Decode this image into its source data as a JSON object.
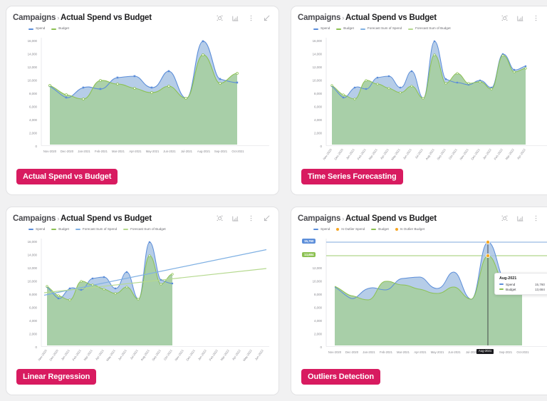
{
  "theme": {
    "badge_color": "#d81b60",
    "spend_color": "#5b8dd9",
    "budget_color": "#8cc152",
    "spend_fill": "#aec6e8",
    "budget_fill": "#a8cfa4",
    "outlier_color": "#f5a623",
    "axis_text": "#8a8a90",
    "card_bg": "#ffffff",
    "page_bg": "#f1f1f2"
  },
  "icons": [
    "focus-target-icon",
    "bar-chart-icon",
    "more-vertical-icon",
    "collapse-arrow-icon"
  ],
  "cards": [
    {
      "id": "actual-spend-vs-budget",
      "breadcrumb": "Campaigns",
      "separator": "›",
      "title": "Actual Spend vs Budget",
      "badge": "Actual Spend vs Budget",
      "legend": [
        {
          "label": "Spend",
          "color": "#5b8dd9",
          "shape": "line"
        },
        {
          "label": "Budget",
          "color": "#8cc152",
          "shape": "line"
        }
      ]
    },
    {
      "id": "time-series-forecasting",
      "breadcrumb": "Campaigns",
      "separator": "›",
      "title": "Actual Spend vs Budget",
      "badge": "Time Series Forecasting",
      "legend": [
        {
          "label": "Spend",
          "color": "#5b8dd9",
          "shape": "line"
        },
        {
          "label": "Budget",
          "color": "#8cc152",
          "shape": "line"
        },
        {
          "label": "Forecast Sum of Spend",
          "color": "#7fb0e3",
          "shape": "line"
        },
        {
          "label": "Forecast Sum of Budget",
          "color": "#b5d98f",
          "shape": "line"
        }
      ]
    },
    {
      "id": "linear-regression",
      "breadcrumb": "Campaigns",
      "separator": "›",
      "title": "Actual Spend vs Budget",
      "badge": "Linear Regression",
      "legend": [
        {
          "label": "Spend",
          "color": "#5b8dd9",
          "shape": "line"
        },
        {
          "label": "Budget",
          "color": "#8cc152",
          "shape": "line"
        },
        {
          "label": "Forecast Sum of Spend",
          "color": "#7fb0e3",
          "shape": "line"
        },
        {
          "label": "Forecast Sum of Budget",
          "color": "#b5d98f",
          "shape": "line"
        }
      ]
    },
    {
      "id": "outliers-detection",
      "breadcrumb": "Campaigns",
      "separator": "›",
      "title": "Actual Spend vs Budget",
      "badge": "Outliers Detection",
      "legend": [
        {
          "label": "Spend",
          "color": "#5b8dd9",
          "shape": "line"
        },
        {
          "label": "Is Outlier Spend",
          "color": "#f5a623",
          "shape": "dot"
        },
        {
          "label": "Budget",
          "color": "#8cc152",
          "shape": "line"
        },
        {
          "label": "Is Outlier Budget",
          "color": "#f5a623",
          "shape": "dot"
        }
      ],
      "annotations": {
        "spend_pill": "15,760",
        "budget_pill": "13,684",
        "x_pill": "Aug-2021",
        "tooltip": {
          "title": "Aug-2021",
          "rows": [
            {
              "label": "Spend",
              "value": "15,760",
              "color": "#5b8dd9"
            },
            {
              "label": "Budget",
              "value": "13,684",
              "color": "#8cc152"
            }
          ]
        }
      }
    }
  ],
  "chart_data": [
    {
      "id": "actual-spend-vs-budget",
      "type": "area",
      "title": "Actual Spend vs Budget",
      "xlabel": "",
      "ylabel": "",
      "ylim": [
        0,
        16000
      ],
      "yticks": [
        "0",
        "2,000",
        "4,000",
        "6,000",
        "8,000",
        "10,000",
        "12,000",
        "14,000",
        "16,000"
      ],
      "grid": false,
      "legend_position": "top-left",
      "rotate_xlabels": false,
      "categories": [
        "Nov-2020",
        "Dec-2020",
        "Jan-2021",
        "Feb-2021",
        "Mar-2021",
        "Apr-2021",
        "May-2021",
        "Jun-2021",
        "Jul-2021",
        "Aug-2021",
        "Sep-2021",
        "Oct-2021"
      ],
      "series": [
        {
          "name": "Spend",
          "color": "#5b8dd9",
          "values": [
            8980,
            7560,
            8820,
            8560,
            9680,
            9860,
            8280,
            10480,
            7200,
            15760,
            10880,
            10900
          ]
        },
        {
          "name": "Budget",
          "color": "#8cc152",
          "values": [
            9120,
            7980,
            7500,
            9760,
            9320,
            8800,
            8080,
            9020,
            7220,
            13684,
            9480,
            11020
          ]
        }
      ]
    },
    {
      "id": "time-series-forecasting",
      "type": "area",
      "title": "Actual Spend vs Budget",
      "xlabel": "",
      "ylabel": "",
      "ylim": [
        0,
        16000
      ],
      "yticks": [
        "0",
        "2,000",
        "4,000",
        "6,000",
        "8,000",
        "10,000",
        "12,000",
        "14,000",
        "16,000"
      ],
      "grid": false,
      "legend_position": "top-left",
      "rotate_xlabels": true,
      "forecast_start_index": 12,
      "categories": [
        "Nov-2020",
        "Dec-2020",
        "Jan-2021",
        "Feb-2021",
        "Mar-2021",
        "Apr-2021",
        "May-2021",
        "Jun-2021",
        "Jul-2021",
        "Aug-2021",
        "Sep-2021",
        "Oct-2021",
        "Nov-2021",
        "Dec-2021",
        "Jan-2022",
        "Feb-2022",
        "Mar-2022",
        "Apr-2022"
      ],
      "series": [
        {
          "name": "Spend",
          "color": "#5b8dd9",
          "values": [
            8980,
            7560,
            8820,
            8560,
            9680,
            9860,
            8280,
            10480,
            7200,
            15760,
            10880,
            10900,
            9620,
            10120,
            8800,
            13800,
            11800,
            12200
          ]
        },
        {
          "name": "Budget",
          "color": "#8cc152",
          "values": [
            9120,
            7980,
            7500,
            9760,
            9320,
            8800,
            8080,
            9020,
            7220,
            13684,
            9480,
            11020,
            9700,
            9900,
            8760,
            13520,
            11300,
            11900
          ]
        },
        {
          "name": "Forecast Sum of Spend",
          "color": "#7fb0e3",
          "values": [
            null,
            null,
            null,
            null,
            null,
            null,
            null,
            null,
            null,
            null,
            null,
            10900,
            9620,
            10120,
            8800,
            13800,
            11800,
            12200
          ]
        },
        {
          "name": "Forecast Sum of Budget",
          "color": "#b5d98f",
          "values": [
            null,
            null,
            null,
            null,
            null,
            null,
            null,
            null,
            null,
            null,
            null,
            11020,
            9700,
            9900,
            8760,
            13520,
            11300,
            11900
          ]
        }
      ]
    },
    {
      "id": "linear-regression",
      "type": "area",
      "title": "Actual Spend vs Budget",
      "xlabel": "",
      "ylabel": "",
      "ylim": [
        0,
        16000
      ],
      "yticks": [
        "0",
        "2,000",
        "4,000",
        "6,000",
        "8,000",
        "10,000",
        "12,000",
        "14,000",
        "16,000"
      ],
      "grid": false,
      "legend_position": "top-left",
      "rotate_xlabels": true,
      "categories": [
        "Nov-2020",
        "Dec-2020",
        "Jan-2021",
        "Feb-2021",
        "Mar-2021",
        "Apr-2021",
        "May-2021",
        "Jun-2021",
        "Jul-2021",
        "Aug-2021",
        "Sep-2021",
        "Oct-2021",
        "Nov-2021",
        "Dec-2021",
        "Jan-2022",
        "Feb-2022",
        "Mar-2022",
        "Apr-2022",
        "May-2022",
        "Jun-2022"
      ],
      "series": [
        {
          "name": "Spend",
          "color": "#5b8dd9",
          "values": [
            8980,
            7560,
            8820,
            8560,
            9680,
            9860,
            8280,
            10480,
            7200,
            15760,
            10880,
            10900
          ]
        },
        {
          "name": "Budget",
          "color": "#8cc152",
          "values": [
            9120,
            7980,
            7500,
            9760,
            9320,
            8800,
            8080,
            9020,
            7220,
            13684,
            9480,
            11020
          ]
        }
      ],
      "trendlines": [
        {
          "name": "Forecast Sum of Spend",
          "color": "#7fb0e3",
          "from": 7800,
          "to": 14700
        },
        {
          "name": "Forecast Sum of Budget",
          "color": "#b5d98f",
          "from": 8180,
          "to": 12200
        }
      ]
    },
    {
      "id": "outliers-detection",
      "type": "area",
      "title": "Actual Spend vs Budget",
      "xlabel": "",
      "ylabel": "",
      "ylim": [
        0,
        16000
      ],
      "yticks": [
        "0",
        "2,000",
        "4,000",
        "6,000",
        "8,000",
        "10,000",
        "12,000"
      ],
      "grid": false,
      "legend_position": "top-left",
      "rotate_xlabels": false,
      "categories": [
        "Nov-2020",
        "Dec-2020",
        "Jan-2021",
        "Feb-2021",
        "Mar-2021",
        "Apr-2021",
        "May-2021",
        "Jun-2021",
        "Jul-2021",
        "Aug-2021",
        "Sep-2021",
        "Oct-2021"
      ],
      "series": [
        {
          "name": "Spend",
          "color": "#5b8dd9",
          "values": [
            8980,
            7560,
            8820,
            8560,
            9680,
            9860,
            8280,
            10480,
            7200,
            15760,
            10880,
            10900
          ]
        },
        {
          "name": "Budget",
          "color": "#8cc152",
          "values": [
            9120,
            7980,
            7500,
            9760,
            9320,
            8800,
            8080,
            9020,
            7220,
            13684,
            9480,
            11020
          ]
        }
      ],
      "outliers": [
        {
          "series": "Spend",
          "category": "Aug-2021",
          "value": 15760,
          "color": "#f5a623"
        },
        {
          "series": "Budget",
          "category": "Aug-2021",
          "value": 13684,
          "color": "#f5a623"
        }
      ],
      "reference_lines": [
        {
          "name": "Spend outlier level",
          "value": 15760,
          "color": "#5b8dd9",
          "label": "15,760"
        },
        {
          "name": "Budget outlier level",
          "value": 13684,
          "color": "#8cc152",
          "label": "13,684"
        }
      ]
    }
  ]
}
